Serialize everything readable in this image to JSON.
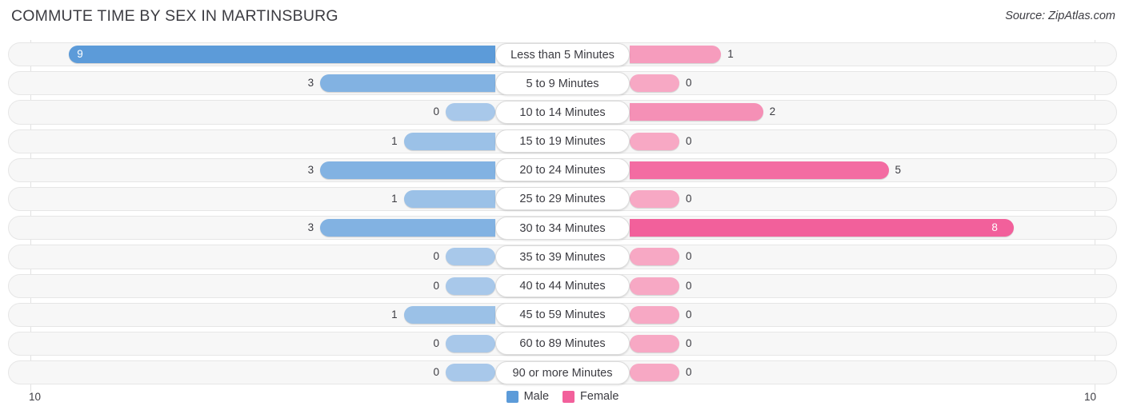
{
  "header": {
    "title": "COMMUTE TIME BY SEX IN MARTINSBURG",
    "source": "Source: ZipAtlas.com"
  },
  "axis": {
    "left_label": "10",
    "right_label": "10"
  },
  "legend": {
    "items": [
      {
        "label": "Male",
        "color": "#5c9bd9"
      },
      {
        "label": "Female",
        "color": "#f2609b"
      }
    ]
  },
  "colors": {
    "male_strong": "#5c9bd9",
    "male_light": "#a8c8ea",
    "female_strong": "#f2609b",
    "female_light": "#f7a8c4",
    "track": "#f7f7f7",
    "text": "#3c3c42"
  },
  "chart_data": {
    "type": "bar",
    "title": "COMMUTE TIME BY SEX IN MARTINSBURG",
    "subtitle": "Source: ZipAtlas.com",
    "orientation": "horizontal-diverging",
    "xlabel": "",
    "ylabel": "",
    "xlim": [
      10,
      10
    ],
    "axis_max": 10,
    "grid": true,
    "legend_position": "bottom-center",
    "categories": [
      "Less than 5 Minutes",
      "5 to 9 Minutes",
      "10 to 14 Minutes",
      "15 to 19 Minutes",
      "20 to 24 Minutes",
      "25 to 29 Minutes",
      "30 to 34 Minutes",
      "35 to 39 Minutes",
      "40 to 44 Minutes",
      "45 to 59 Minutes",
      "60 to 89 Minutes",
      "90 or more Minutes"
    ],
    "series": [
      {
        "name": "Male",
        "color": "#5c9bd9",
        "values": [
          9,
          3,
          0,
          1,
          3,
          1,
          3,
          0,
          0,
          1,
          0,
          0
        ]
      },
      {
        "name": "Female",
        "color": "#f2609b",
        "values": [
          1,
          0,
          2,
          0,
          5,
          0,
          8,
          0,
          0,
          0,
          0,
          0
        ]
      }
    ]
  }
}
